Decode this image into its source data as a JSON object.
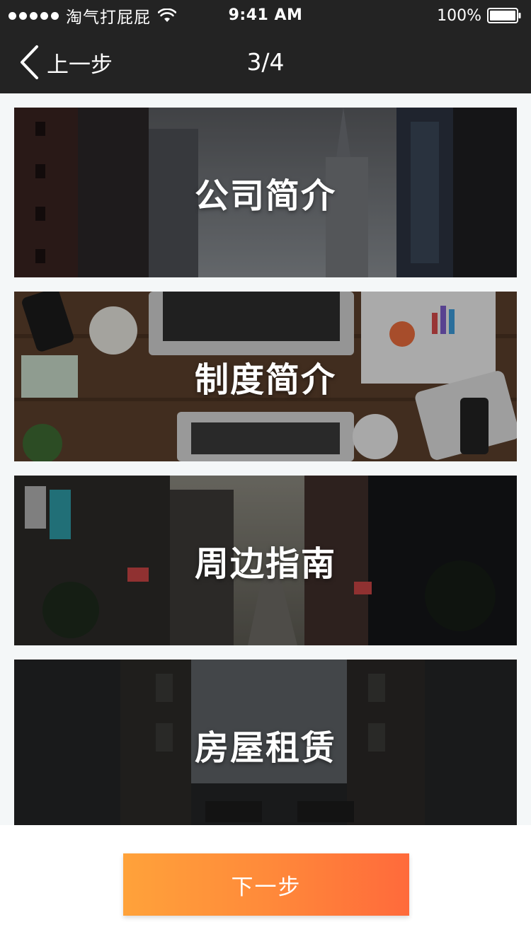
{
  "status_bar": {
    "carrier": "淘气打屁屁",
    "time": "9:41 AM",
    "battery_percent": "100%",
    "signal_icon": "signal-dots-icon",
    "wifi_icon": "wifi-icon",
    "battery_icon": "battery-full-icon"
  },
  "nav": {
    "back_label": "上一步",
    "back_icon": "chevron-left-icon",
    "title": "3/4"
  },
  "cards": [
    {
      "title": "公司简介"
    },
    {
      "title": "制度简介"
    },
    {
      "title": "周边指南"
    },
    {
      "title": "房屋租赁"
    }
  ],
  "footer": {
    "next_label": "下一步"
  },
  "colors": {
    "header_bg": "#232323",
    "page_bg": "#f4f7f8",
    "button_gradient_start": "#ffa23a",
    "button_gradient_end": "#ff6a3b"
  }
}
